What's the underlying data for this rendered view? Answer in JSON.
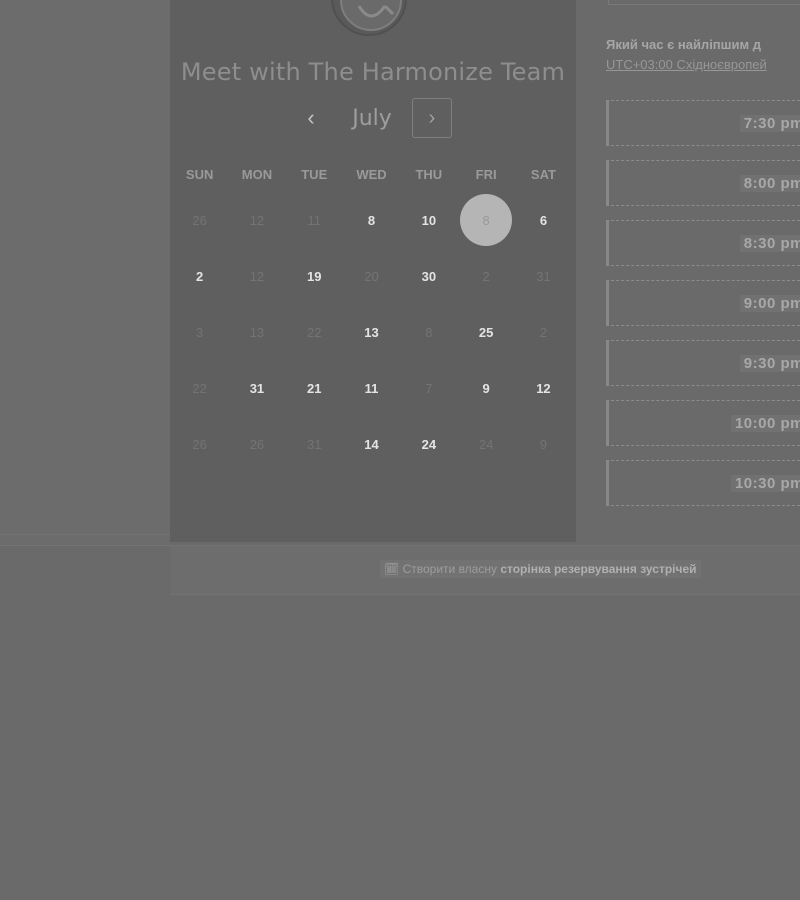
{
  "profile": {
    "avatar_icon": "team-logo",
    "title": "Meet with The Harmonize Team"
  },
  "calendar": {
    "month": "July",
    "prev_icon": "chevron-left",
    "prev_label": "‹",
    "next_icon": "chevron-right",
    "next_label": "›",
    "weekdays": [
      "SUN",
      "MON",
      "TUE",
      "WED",
      "THU",
      "FRI",
      "SAT"
    ],
    "weeks": [
      [
        {
          "d": "26",
          "s": "muted"
        },
        {
          "d": "12",
          "s": "muted"
        },
        {
          "d": "11",
          "s": "muted"
        },
        {
          "d": "8",
          "s": "active"
        },
        {
          "d": "10",
          "s": "active"
        },
        {
          "d": "8",
          "s": "selected"
        },
        {
          "d": "6",
          "s": "active"
        }
      ],
      [
        {
          "d": "2",
          "s": "active"
        },
        {
          "d": "12",
          "s": "muted"
        },
        {
          "d": "19",
          "s": "active"
        },
        {
          "d": "20",
          "s": "muted"
        },
        {
          "d": "30",
          "s": "active"
        },
        {
          "d": "2",
          "s": "muted"
        },
        {
          "d": "31",
          "s": "muted"
        }
      ],
      [
        {
          "d": "3",
          "s": "muted"
        },
        {
          "d": "13",
          "s": "muted"
        },
        {
          "d": "22",
          "s": "muted"
        },
        {
          "d": "13",
          "s": "active"
        },
        {
          "d": "8",
          "s": "muted"
        },
        {
          "d": "25",
          "s": "active"
        },
        {
          "d": "2",
          "s": "muted"
        }
      ],
      [
        {
          "d": "22",
          "s": "muted"
        },
        {
          "d": "31",
          "s": "active"
        },
        {
          "d": "21",
          "s": "active"
        },
        {
          "d": "11",
          "s": "active"
        },
        {
          "d": "7",
          "s": "muted"
        },
        {
          "d": "9",
          "s": "active"
        },
        {
          "d": "12",
          "s": "active"
        }
      ],
      [
        {
          "d": "26",
          "s": "muted"
        },
        {
          "d": "26",
          "s": "muted"
        },
        {
          "d": "31",
          "s": "muted"
        },
        {
          "d": "14",
          "s": "active"
        },
        {
          "d": "24",
          "s": "active"
        },
        {
          "d": "24",
          "s": "muted"
        },
        {
          "d": "9",
          "s": "muted"
        }
      ]
    ]
  },
  "times": {
    "question": "Який час є найліпшим д",
    "timezone": "UTC+03:00 Східноєвропей",
    "slots": [
      "7:30 pm",
      "8:00 pm",
      "8:30 pm",
      "9:00 pm",
      "9:30 pm",
      "10:00 pm",
      "10:30 pm"
    ]
  },
  "footer": {
    "icon": "calendar-icon",
    "prefix": "Створити власну ",
    "link": "сторінка резервування зустрічей"
  },
  "colors": {
    "background": "#6a6a6a",
    "panel": "#5f5f5f",
    "selected_day": "#b5b5b5"
  }
}
